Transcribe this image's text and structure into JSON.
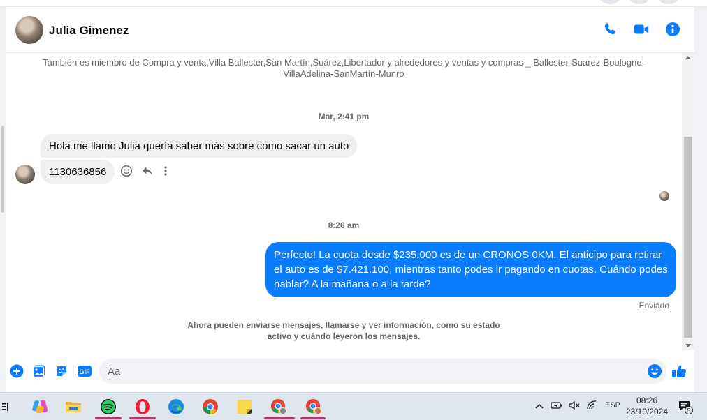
{
  "header": {
    "contact_name": "Julia Gimenez",
    "icons": [
      "phone-icon",
      "video-camera-icon",
      "info-icon"
    ]
  },
  "conversation": {
    "member_info": "También es miembro de Compra y venta,Villa Ballester,San Martín,Suárez,Libertador y alrededores y ventas y compras _ Ballester-Suarez-Boulogne-VillaAdelina-SanMartín-Munro",
    "timestamp_1": "Mar, 2:41 pm",
    "incoming_1": "Hola  me llamo Julia quería saber más sobre como sacar un auto",
    "incoming_2": "1130636856",
    "timestamp_2": "8:26 am",
    "outgoing_1": "Perfecto! La cuota desde $235.000 es de un CRONOS 0KM. El anticipo para retirar el auto es de $7.421.100, mientras tanto podes ir pagando en cuotas. Cuándo podes hablar? A la mañana o a la tarde?",
    "sent_status": "Enviado",
    "notice": "Ahora pueden enviarse mensajes, llamarse y ver información, como su estado activo y cuándo leyeron los mensajes."
  },
  "composer": {
    "placeholder": "Aa"
  },
  "colors": {
    "accent": "#0a7cff",
    "incoming_bubble": "#f0f0f0"
  },
  "taskbar": {
    "tray_language": "ESP",
    "time": "08:26",
    "date": "23/10/2024",
    "notification_count": "5"
  }
}
